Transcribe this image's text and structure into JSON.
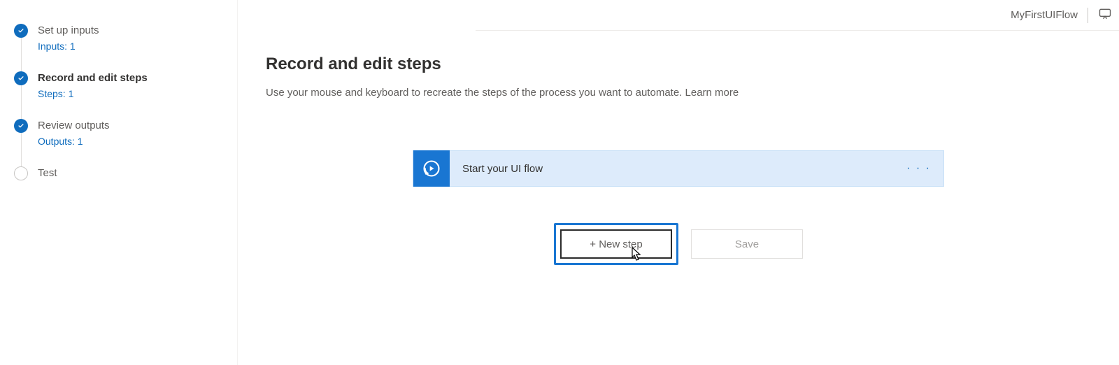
{
  "topbar": {
    "flow_name": "MyFirstUIFlow"
  },
  "sidebar": {
    "steps": [
      {
        "title": "Set up inputs",
        "sub": "Inputs: 1",
        "state": "complete"
      },
      {
        "title": "Record and edit steps",
        "sub": "Steps: 1",
        "state": "complete",
        "active": true
      },
      {
        "title": "Review outputs",
        "sub": "Outputs: 1",
        "state": "complete"
      },
      {
        "title": "Test",
        "sub": "",
        "state": "pending"
      }
    ]
  },
  "main": {
    "title": "Record and edit steps",
    "description_prefix": "Use your mouse and keyboard to recreate the steps of the process you want to automate.  ",
    "learn_more": "Learn more"
  },
  "flow_card": {
    "title": "Start your UI flow",
    "menu_glyph": "· · ·"
  },
  "buttons": {
    "new_step": "+ New step",
    "save": "Save"
  }
}
